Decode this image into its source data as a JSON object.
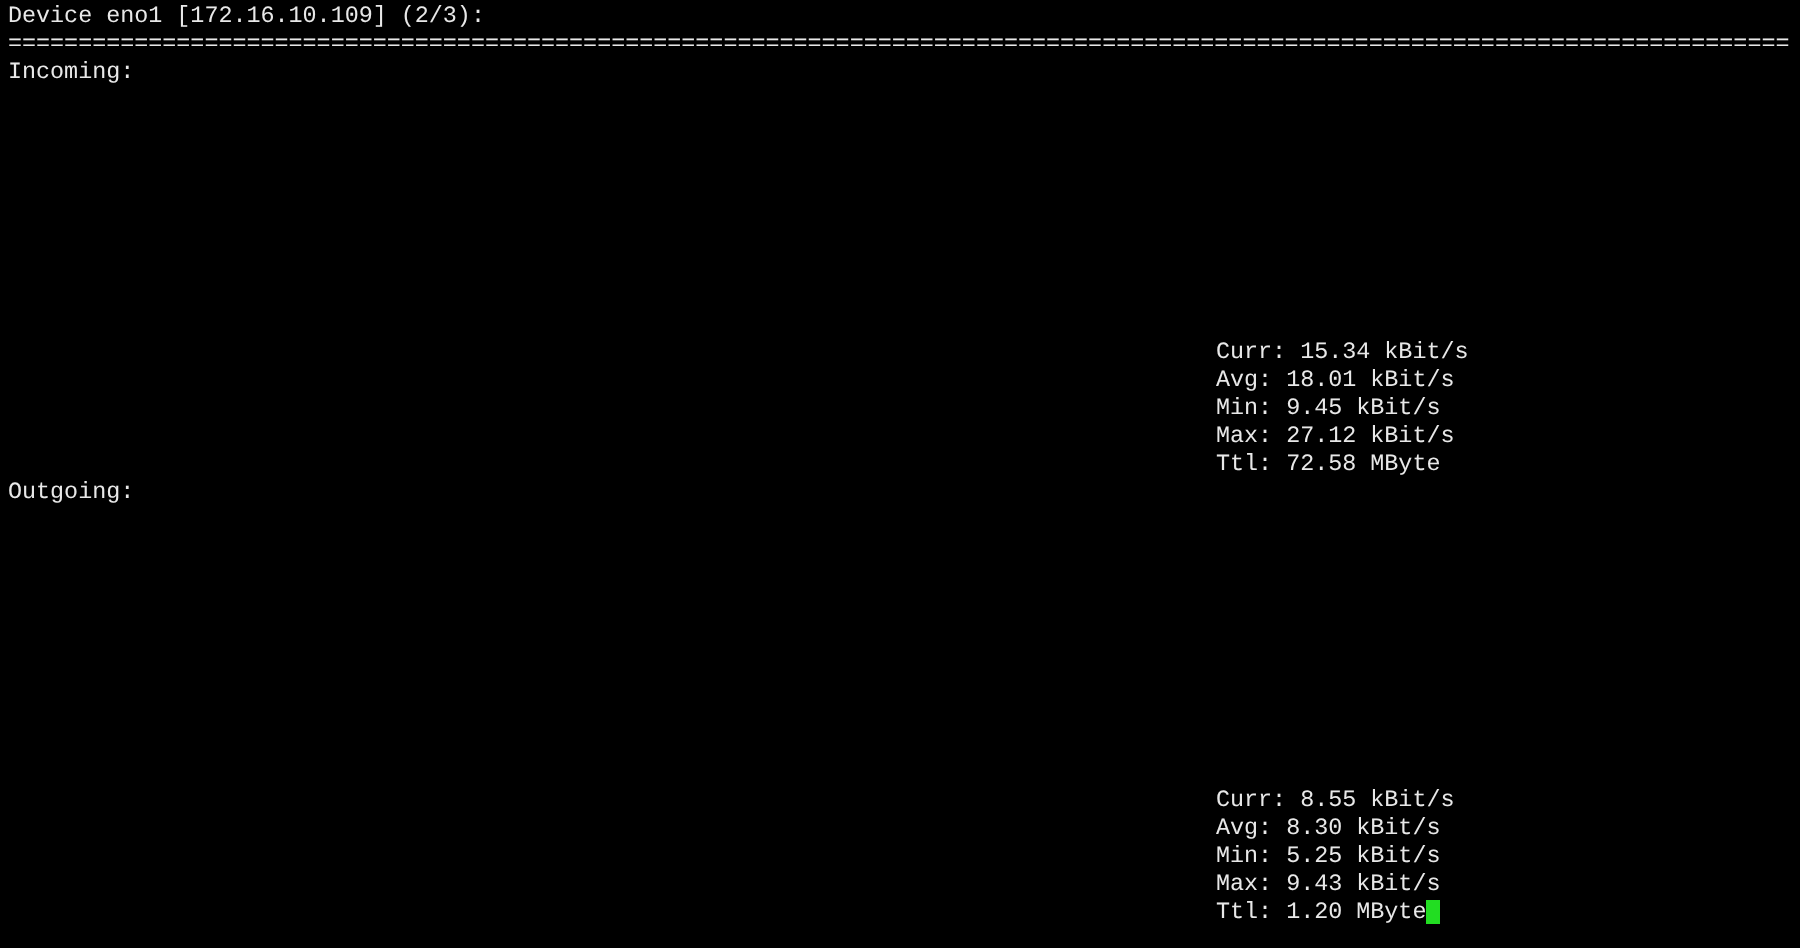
{
  "header": {
    "title": "Device eno1 [172.16.10.109] (2/3):",
    "rule": "==============================================================================================================================="
  },
  "sections": [
    {
      "label": "Incoming:",
      "stats": [
        "Curr: 15.34 kBit/s",
        "Avg: 18.01 kBit/s",
        "Min: 9.45 kBit/s",
        "Max: 27.12 kBit/s",
        "Ttl: 72.58 MByte"
      ]
    },
    {
      "label": "Outgoing:",
      "stats": [
        "Curr: 8.55 kBit/s",
        "Avg: 8.30 kBit/s",
        "Min: 5.25 kBit/s",
        "Max: 9.43 kBit/s",
        "Ttl: 1.20 MByte"
      ],
      "cursor": true
    }
  ]
}
